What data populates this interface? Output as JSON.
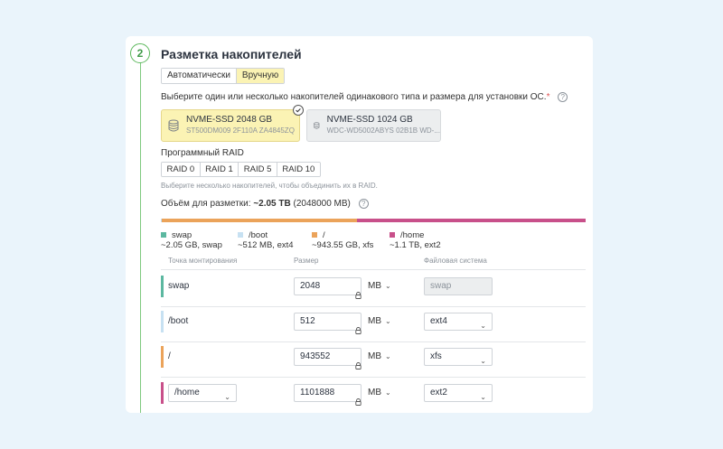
{
  "step": {
    "number": "2",
    "title": "Разметка накопителей"
  },
  "mode": {
    "options": [
      "Автоматически",
      "Вручную"
    ],
    "active": "Вручную"
  },
  "prompt": {
    "text": "Выберите один или несколько накопителей одинакового типа и размера для установки ОС.",
    "required_mark": "*",
    "help": "?"
  },
  "disks": [
    {
      "name": "NVME-SSD 2048 GB",
      "serial": "ST500DM009 2F110A ZA4845ZQ",
      "selected": true
    },
    {
      "name": "NVME-SSD 1024 GB",
      "serial": "WDC-WD5002ABYS 02B1B WD-...",
      "selected": false
    }
  ],
  "raid": {
    "label": "Программный RAID",
    "options": [
      "RAID 0",
      "RAID 1",
      "RAID 5",
      "RAID 10"
    ],
    "hint": "Выберите несколько накопителей, чтобы объединить их в RAID."
  },
  "volume": {
    "label": "Объём для разметки:",
    "value": "~2.05 TB",
    "extra": "(2048000 MB)",
    "help": "?"
  },
  "colors": {
    "swap": "#5cb8a0",
    "boot": "#c7e1f2",
    "root": "#eba35a",
    "home": "#c8508a",
    "accent_green": "#5cb85c",
    "selected_yellow": "#fbf3b4"
  },
  "allocation_fractions": {
    "swap": 0.001,
    "boot": 0.0003,
    "root": 0.46,
    "home": 0.5387
  },
  "legend": [
    {
      "name": "swap",
      "desc": "~2.05 GB, swap"
    },
    {
      "name": "/boot",
      "desc": "~512 MB, ext4"
    },
    {
      "name": "/",
      "desc": "~943.55 GB, xfs"
    },
    {
      "name": "/home",
      "desc": "~1.1 TB, ext2"
    }
  ],
  "columns": {
    "mount": "Точка монтирования",
    "size": "Размер",
    "fs": "Файловая система"
  },
  "partitions": [
    {
      "mount": "swap",
      "size": "2048",
      "unit": "MB",
      "fs": "swap"
    },
    {
      "mount": "/boot",
      "size": "512",
      "unit": "MB",
      "fs": "ext4"
    },
    {
      "mount": "/",
      "size": "943552",
      "unit": "MB",
      "fs": "xfs"
    },
    {
      "mount": "/home",
      "size": "1101888",
      "unit": "MB",
      "fs": "ext2"
    }
  ]
}
